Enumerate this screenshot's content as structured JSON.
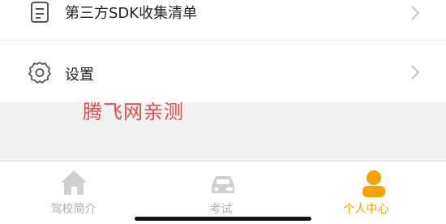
{
  "menu": {
    "sdk_list_label": "第三方SDK收集清单",
    "settings_label": "设置"
  },
  "watermark": "腾飞网亲测",
  "tabs": [
    {
      "label": "驾校简介",
      "icon": "house-icon",
      "active": false
    },
    {
      "label": "考试",
      "icon": "car-icon",
      "active": false
    },
    {
      "label": "个人中心",
      "icon": "person-icon",
      "active": true
    }
  ],
  "colors": {
    "accent": "#f5a300",
    "inactive": "#b0b0b0",
    "watermark": "#e64a4a"
  }
}
